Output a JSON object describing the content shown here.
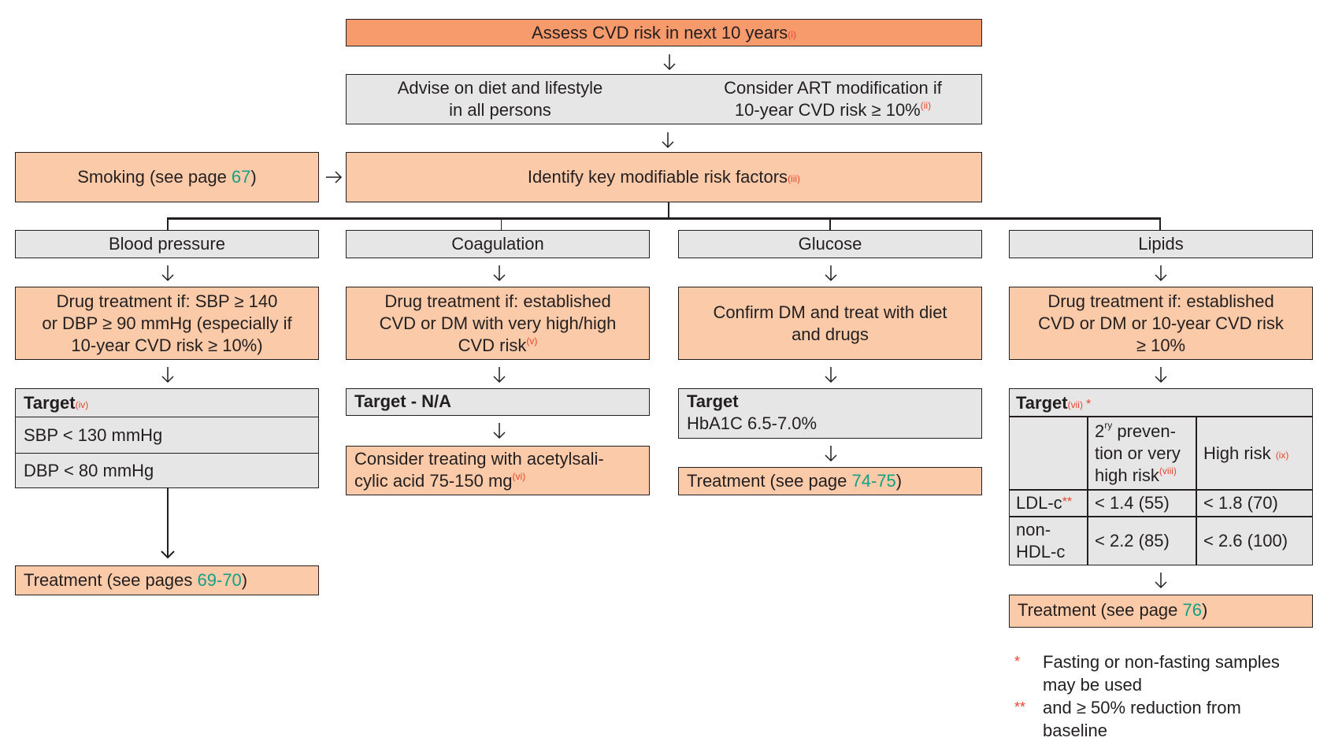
{
  "colors": {
    "primary_box": "#f79a6c",
    "secondary_box": "#fbcaa8",
    "neutral_box": "#e6e6e6",
    "page_link": "#14a085",
    "footnote_ref": "#e8452c"
  },
  "top": {
    "assess": {
      "text": "Assess CVD risk in next 10 years",
      "ref": "(i)"
    },
    "advise": {
      "text_line1": "Advise on diet and lifestyle",
      "text_line2": "in all persons"
    },
    "art": {
      "text_line1": "Consider ART modification if",
      "text_line2": "10-year CVD risk ≥ 10%",
      "ref": "(ii)"
    },
    "smoking": {
      "text": "Smoking (see page ",
      "page": "67",
      "close": ")"
    },
    "identify": {
      "text": "Identify key modifiable risk factors",
      "ref": "(iii)"
    }
  },
  "columns": {
    "blood_pressure": {
      "title": "Blood pressure",
      "drug_line1": "Drug treatment if: SBP ≥ 140",
      "drug_line2": "or DBP ≥ 90 mmHg (especially if",
      "drug_line3": "10-year CVD risk ≥ 10%)",
      "target_label": "Target",
      "target_ref": "(iv)",
      "targets": [
        "SBP < 130 mmHg",
        "DBP < 80  mmHg"
      ],
      "treatment": {
        "text": "Treatment (see pages ",
        "page": "69-70",
        "close": ")"
      }
    },
    "coagulation": {
      "title": "Coagulation",
      "drug_line1": "Drug treatment if: established",
      "drug_line2": "CVD or DM with very high/high",
      "drug_line3": "CVD risk",
      "drug_ref": "(v)",
      "target_label": "Target - N/A",
      "consider_line1": "Consider treating with acetylsali-",
      "consider_line2": "cylic acid 75-150 mg",
      "consider_ref": "(vi)"
    },
    "glucose": {
      "title": "Glucose",
      "drug_line1": "Confirm DM and treat with diet",
      "drug_line2": "and drugs",
      "target_label": "Target",
      "target_value": "HbA1C  6.5-7.0%",
      "treatment": {
        "text": "Treatment (see page ",
        "page": "74-75",
        "close": ")"
      }
    },
    "lipids": {
      "title": "Lipids",
      "drug_line1": "Drug treatment if: established",
      "drug_line2": "CVD or DM or 10-year CVD risk",
      "drug_line3": "≥ 10%",
      "target_label": "Target",
      "target_ref": "(vii)",
      "target_mark": "*",
      "table": {
        "col1_pre": "2",
        "col1_sup": "ry",
        "col1_line1": " preven-",
        "col1_line2": "tion or very",
        "col1_line3": "high risk",
        "col1_ref": "(viii)",
        "col2": "High risk ",
        "col2_ref": "(ix)",
        "rows": [
          {
            "label": "LDL-c",
            "mark": "**",
            "v1": "< 1.4 (55)",
            "v2": "< 1.8 (70)"
          },
          {
            "label_line1": "non-",
            "label_line2": "HDL-c",
            "v1": "< 2.2 (85)",
            "v2": "< 2.6 (100)"
          }
        ]
      },
      "treatment": {
        "text": "Treatment (see page ",
        "page": "76",
        "close": ")"
      }
    }
  },
  "footnotes": [
    {
      "mark": "*",
      "line1": "Fasting or non-fasting samples",
      "line2": "may be used"
    },
    {
      "mark": "**",
      "line1": "and ≥ 50% reduction from",
      "line2": "baseline"
    }
  ]
}
